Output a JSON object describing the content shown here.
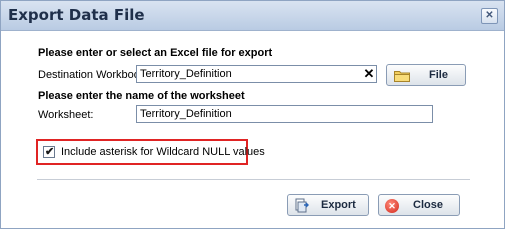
{
  "window": {
    "title": "Export Data File",
    "close_glyph": "✕"
  },
  "section1": {
    "heading": "Please enter or select an Excel file for export"
  },
  "workbook": {
    "label": "Destination Workbook:",
    "value": "Territory_Definition",
    "clear_glyph": "✕"
  },
  "file_button": {
    "label": "File",
    "icon": "folder-icon"
  },
  "section2": {
    "heading": "Please enter the name of the worksheet"
  },
  "worksheet": {
    "label": "Worksheet:",
    "value": "Territory_Definition"
  },
  "wildcard": {
    "label": "Include asterisk for Wildcard NULL values",
    "checked": true,
    "checkmark": "✔",
    "highlight_color": "#e02424"
  },
  "actions": {
    "export_label": "Export",
    "export_icon": "export-icon",
    "close_label": "Close",
    "close_icon": "close-icon",
    "close_icon_glyph": "✕"
  }
}
